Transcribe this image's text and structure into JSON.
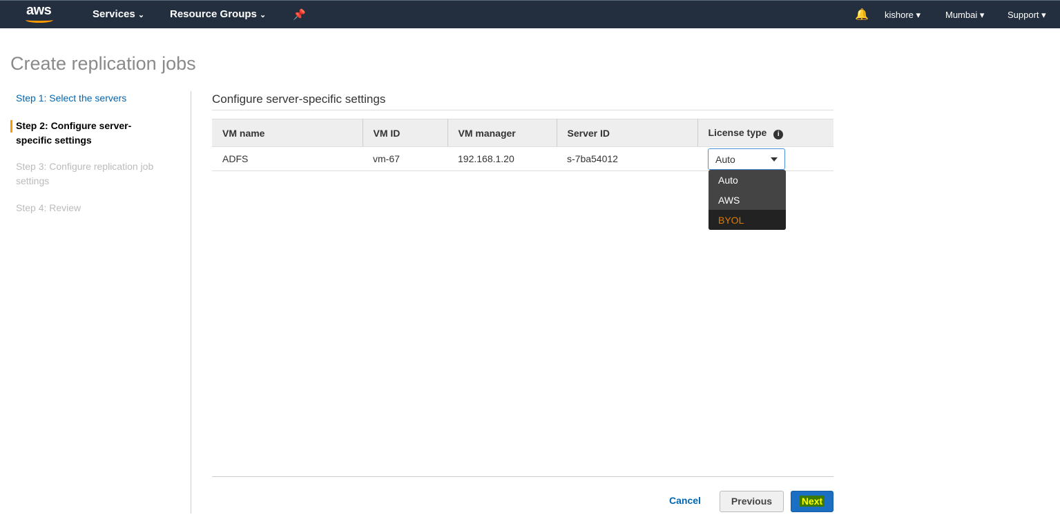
{
  "nav": {
    "logo": "aws",
    "services": "Services",
    "resource_groups": "Resource Groups",
    "user": "kishore",
    "region": "Mumbai",
    "support": "Support"
  },
  "page": {
    "title": "Create replication jobs"
  },
  "steps": [
    "Step 1: Select the servers",
    "Step 2: Configure server-specific settings",
    "Step 3: Configure replication job settings",
    "Step 4: Review"
  ],
  "section": {
    "title": "Configure server-specific settings"
  },
  "table": {
    "headers": [
      "VM name",
      "VM ID",
      "VM manager",
      "Server ID",
      "License type"
    ],
    "rows": [
      {
        "vm_name": "ADFS",
        "vm_id": "vm-67",
        "vm_manager": "192.168.1.20",
        "server_id": "s-7ba54012",
        "license": "Auto"
      }
    ]
  },
  "dropdown": {
    "options": [
      "Auto",
      "AWS",
      "BYOL"
    ],
    "highlighted": "BYOL"
  },
  "footer": {
    "cancel": "Cancel",
    "previous": "Previous",
    "next": "Next"
  },
  "colors": {
    "nav_bg": "#232f3e",
    "accent": "#ff9900",
    "link": "#0066b2",
    "primary": "#1a6fc4"
  }
}
